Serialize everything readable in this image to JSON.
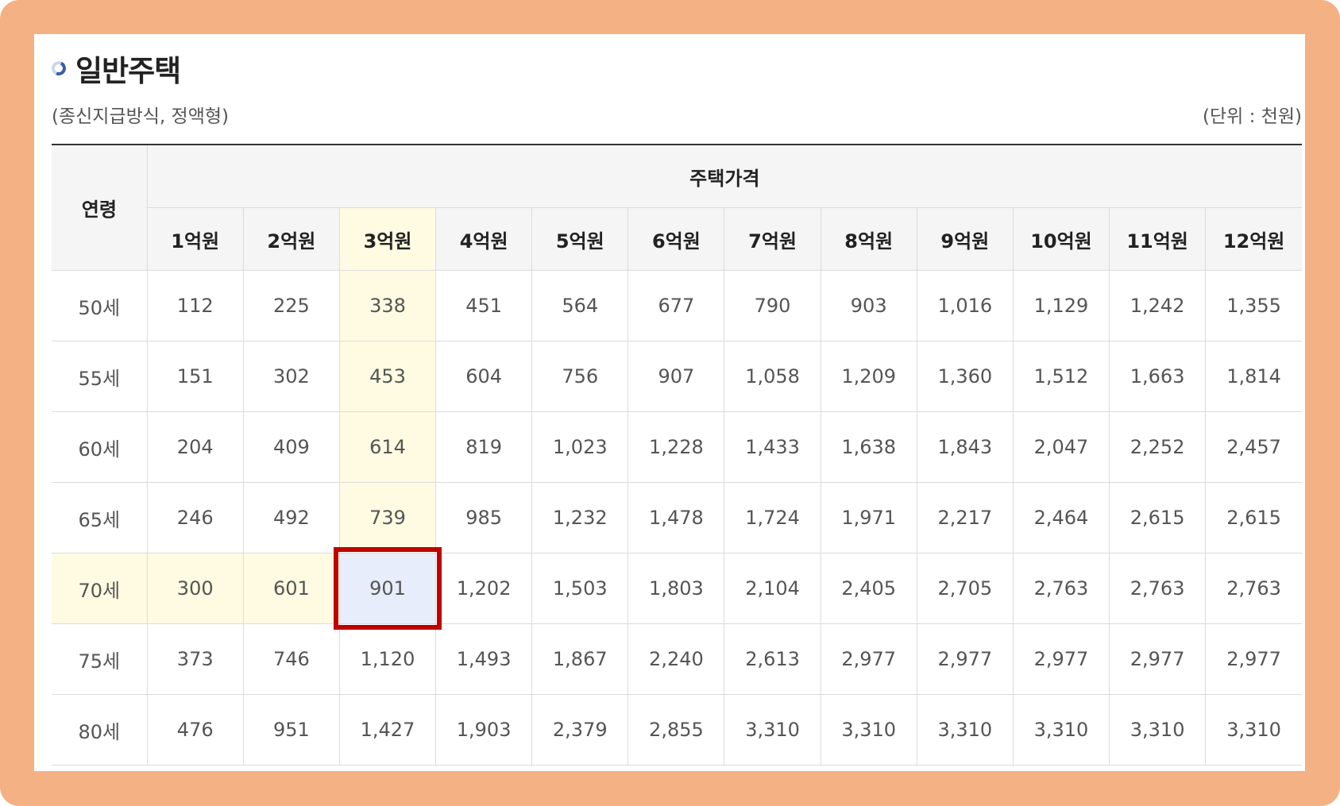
{
  "header": {
    "title": "일반주택",
    "subtitle": "(종신지급방식, 정액형)",
    "unit": "(단위 : 천원)"
  },
  "table": {
    "row_header": "연령",
    "group_header": "주택가격",
    "columns": [
      "1억원",
      "2억원",
      "3억원",
      "4억원",
      "5억원",
      "6억원",
      "7억원",
      "8억원",
      "9억원",
      "10억원",
      "11억원",
      "12억원"
    ],
    "rows": [
      {
        "age": "50세",
        "values": [
          "112",
          "225",
          "338",
          "451",
          "564",
          "677",
          "790",
          "903",
          "1,016",
          "1,129",
          "1,242",
          "1,355"
        ]
      },
      {
        "age": "55세",
        "values": [
          "151",
          "302",
          "453",
          "604",
          "756",
          "907",
          "1,058",
          "1,209",
          "1,360",
          "1,512",
          "1,663",
          "1,814"
        ]
      },
      {
        "age": "60세",
        "values": [
          "204",
          "409",
          "614",
          "819",
          "1,023",
          "1,228",
          "1,433",
          "1,638",
          "1,843",
          "2,047",
          "2,252",
          "2,457"
        ]
      },
      {
        "age": "65세",
        "values": [
          "246",
          "492",
          "739",
          "985",
          "1,232",
          "1,478",
          "1,724",
          "1,971",
          "2,217",
          "2,464",
          "2,615",
          "2,615"
        ]
      },
      {
        "age": "70세",
        "values": [
          "300",
          "601",
          "901",
          "1,202",
          "1,503",
          "1,803",
          "2,104",
          "2,405",
          "2,705",
          "2,763",
          "2,763",
          "2,763"
        ]
      },
      {
        "age": "75세",
        "values": [
          "373",
          "746",
          "1,120",
          "1,493",
          "1,867",
          "2,240",
          "2,613",
          "2,977",
          "2,977",
          "2,977",
          "2,977",
          "2,977"
        ]
      },
      {
        "age": "80세",
        "values": [
          "476",
          "951",
          "1,427",
          "1,903",
          "2,379",
          "2,855",
          "3,310",
          "3,310",
          "3,310",
          "3,310",
          "3,310",
          "3,310"
        ]
      }
    ],
    "highlight": {
      "column_index": 2,
      "row_index": 4
    },
    "colors": {
      "highlight_bg": "#fefbe2",
      "selected_bg": "#e7edfb",
      "selected_border": "#c00000",
      "frame": "#f4b183"
    }
  }
}
